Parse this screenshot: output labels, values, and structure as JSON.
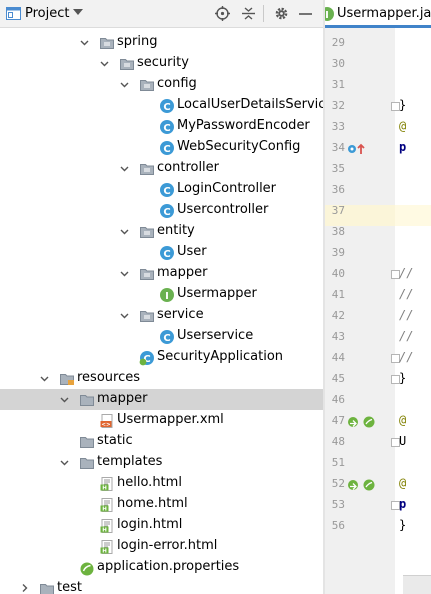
{
  "panel": {
    "title": "Project",
    "icons": [
      "crosshair-icon",
      "collapse-all-icon",
      "gear-icon",
      "hide-icon"
    ]
  },
  "tree": [
    {
      "label": "spring",
      "type": "package",
      "depth": 4,
      "expanded": true
    },
    {
      "label": "security",
      "type": "package",
      "depth": 5,
      "expanded": true
    },
    {
      "label": "config",
      "type": "package",
      "depth": 6,
      "expanded": true
    },
    {
      "label": "LocalUserDetailsService",
      "type": "class",
      "depth": 7
    },
    {
      "label": "MyPasswordEncoder",
      "type": "class",
      "depth": 7
    },
    {
      "label": "WebSecurityConfig",
      "type": "class",
      "depth": 7
    },
    {
      "label": "controller",
      "type": "package",
      "depth": 6,
      "expanded": true
    },
    {
      "label": "LoginController",
      "type": "class",
      "depth": 7
    },
    {
      "label": "Usercontroller",
      "type": "class",
      "depth": 7
    },
    {
      "label": "entity",
      "type": "package",
      "depth": 6,
      "expanded": true
    },
    {
      "label": "User",
      "type": "class",
      "depth": 7
    },
    {
      "label": "mapper",
      "type": "package",
      "depth": 6,
      "expanded": true
    },
    {
      "label": "Usermapper",
      "type": "interface",
      "depth": 7
    },
    {
      "label": "service",
      "type": "package",
      "depth": 6,
      "expanded": true
    },
    {
      "label": "Userservice",
      "type": "class",
      "depth": 7
    },
    {
      "label": "SecurityApplication",
      "type": "spring-class",
      "depth": 6
    },
    {
      "label": "resources",
      "type": "resources-folder",
      "depth": 2,
      "expanded": true
    },
    {
      "label": "mapper",
      "type": "folder",
      "depth": 3,
      "expanded": true,
      "selected": true
    },
    {
      "label": "Usermapper.xml",
      "type": "xml",
      "depth": 4
    },
    {
      "label": "static",
      "type": "folder",
      "depth": 3
    },
    {
      "label": "templates",
      "type": "folder",
      "depth": 3,
      "expanded": true
    },
    {
      "label": "hello.html",
      "type": "html",
      "depth": 4
    },
    {
      "label": "home.html",
      "type": "html",
      "depth": 4
    },
    {
      "label": "login.html",
      "type": "html",
      "depth": 4
    },
    {
      "label": "login-error.html",
      "type": "html",
      "depth": 4
    },
    {
      "label": "application.properties",
      "type": "properties",
      "depth": 3
    },
    {
      "label": "test",
      "type": "folder",
      "depth": 1,
      "expanded": false
    }
  ],
  "editor": {
    "tab_label": "Usermapper.java",
    "lines": [
      {
        "n": "29",
        "code": ""
      },
      {
        "n": "30",
        "code": ""
      },
      {
        "n": "31",
        "code": ""
      },
      {
        "n": "32",
        "code": "}",
        "fold": true
      },
      {
        "n": "33",
        "code": "@",
        "style": "ann"
      },
      {
        "n": "34",
        "code": "p",
        "style": "kw",
        "marker": "override"
      },
      {
        "n": "35",
        "code": ""
      },
      {
        "n": "36",
        "code": ""
      },
      {
        "n": "37",
        "code": ""
      },
      {
        "n": "38",
        "code": ""
      },
      {
        "n": "39",
        "code": ""
      },
      {
        "n": "40",
        "code": "//",
        "style": "cmt",
        "fold": true
      },
      {
        "n": "41",
        "code": " //",
        "style": "cmt"
      },
      {
        "n": "42",
        "code": " //",
        "style": "cmt"
      },
      {
        "n": "43",
        "code": " //",
        "style": "cmt"
      },
      {
        "n": "44",
        "code": "//",
        "style": "cmt",
        "fold": true
      },
      {
        "n": "45",
        "code": "}",
        "fold": true
      },
      {
        "n": "46",
        "code": ""
      },
      {
        "n": "47",
        "code": "@",
        "style": "ann",
        "marker": "bean"
      },
      {
        "n": "48",
        "code": "U",
        "fold": true
      },
      {
        "n": "51",
        "code": ""
      },
      {
        "n": "52",
        "code": "@",
        "style": "ann",
        "marker": "bean"
      },
      {
        "n": "53",
        "code": "p",
        "style": "kw",
        "fold": true
      },
      {
        "n": "56",
        "code": "}"
      }
    ]
  },
  "colors": {
    "selection": "#d4d4d4",
    "class_icon": "#3c9ad6",
    "interface_icon": "#6ab150",
    "folder": "#9ba3ad",
    "caret_line": "#fffae3"
  }
}
